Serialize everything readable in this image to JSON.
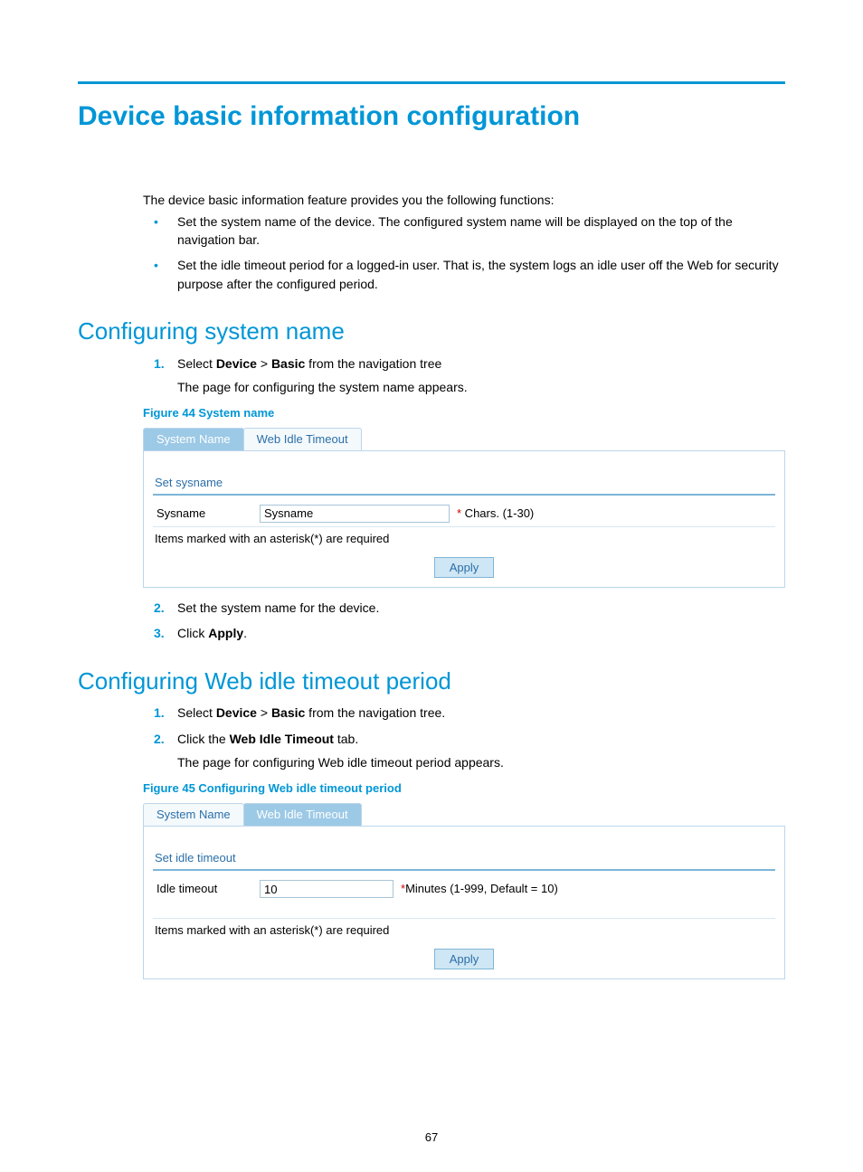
{
  "title": "Device basic information configuration",
  "intro": "The device basic information feature provides you the following functions:",
  "bullets": [
    "Set the system name of the device. The configured system name will be displayed on the top of the navigation bar.",
    "Set the idle timeout period for a logged-in user. That is, the system logs an idle user off the Web for security purpose after the configured period."
  ],
  "section1": {
    "heading": "Configuring system name",
    "step1_pre": "Select ",
    "nav_device": "Device",
    "nav_sep": " > ",
    "nav_basic": "Basic",
    "step1_post": " from the navigation tree",
    "step1_sub": "The page for configuring the system name appears.",
    "fig_caption": "Figure 44 System name",
    "tab_sysname": "System Name",
    "tab_idle": "Web Idle Timeout",
    "legend": "Set sysname",
    "field_label": "Sysname",
    "field_value": "Sysname",
    "field_help": " Chars. (1-30)",
    "asterisk": "*",
    "required_note": "Items marked with an asterisk(*) are required",
    "apply": "Apply",
    "step2": "Set the system name for the device.",
    "step3_pre": "Click ",
    "step3_bold": "Apply",
    "step3_post": "."
  },
  "section2": {
    "heading": "Configuring Web idle timeout period",
    "step1_pre": "Select ",
    "nav_device": "Device",
    "nav_sep": " > ",
    "nav_basic": "Basic",
    "step1_post": " from the navigation tree.",
    "step2_pre": "Click the ",
    "step2_bold": "Web Idle Timeout",
    "step2_post": " tab.",
    "step2_sub": "The page for configuring Web idle timeout period appears.",
    "fig_caption": "Figure 45 Configuring Web idle timeout period",
    "tab_sysname": "System Name",
    "tab_idle": "Web Idle Timeout",
    "legend": "Set idle timeout",
    "field_label": "Idle timeout",
    "field_value": "10",
    "field_help": "Minutes (1-999, Default = 10)",
    "asterisk": "*",
    "required_note": "Items marked with an asterisk(*) are required",
    "apply": "Apply"
  },
  "page_number": "67"
}
